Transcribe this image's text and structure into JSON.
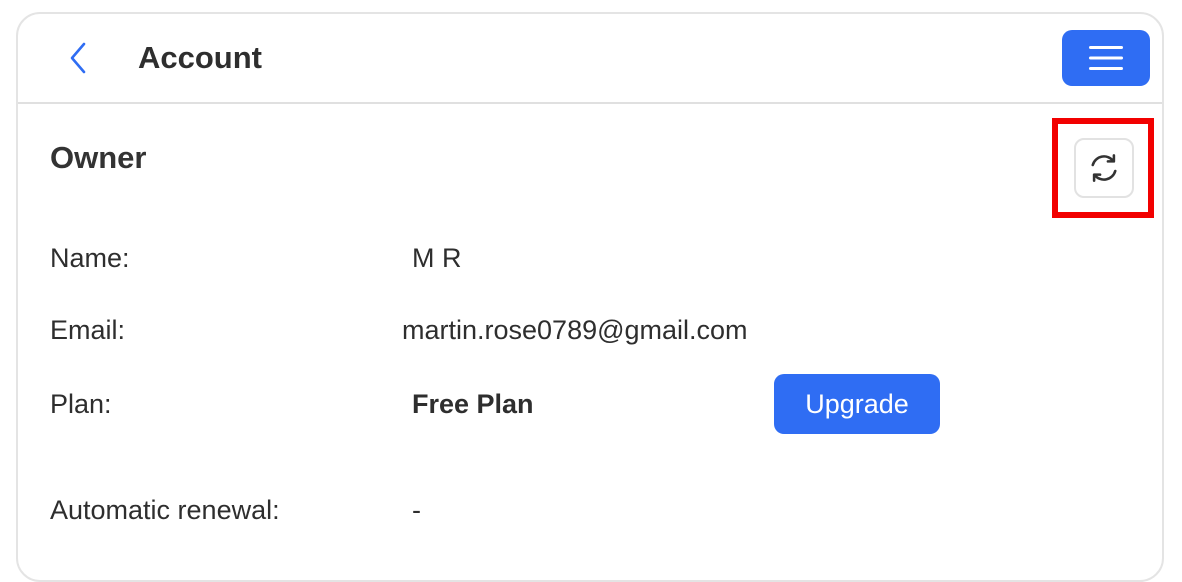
{
  "header": {
    "title": "Account",
    "back_icon": "chevron-left-icon",
    "menu_icon": "hamburger-menu-icon"
  },
  "owner": {
    "section_title": "Owner",
    "refresh_icon": "refresh-icon",
    "fields": {
      "name_label": "Name:",
      "name_value": "M R",
      "email_label": "Email:",
      "email_value": "martin.rose0789@gmail.com",
      "plan_label": "Plan:",
      "plan_value": "Free Plan",
      "upgrade_label": "Upgrade",
      "renewal_label": "Automatic renewal:",
      "renewal_value": "-"
    }
  },
  "colors": {
    "accent": "#2f6df3",
    "highlight": "#f20000"
  }
}
